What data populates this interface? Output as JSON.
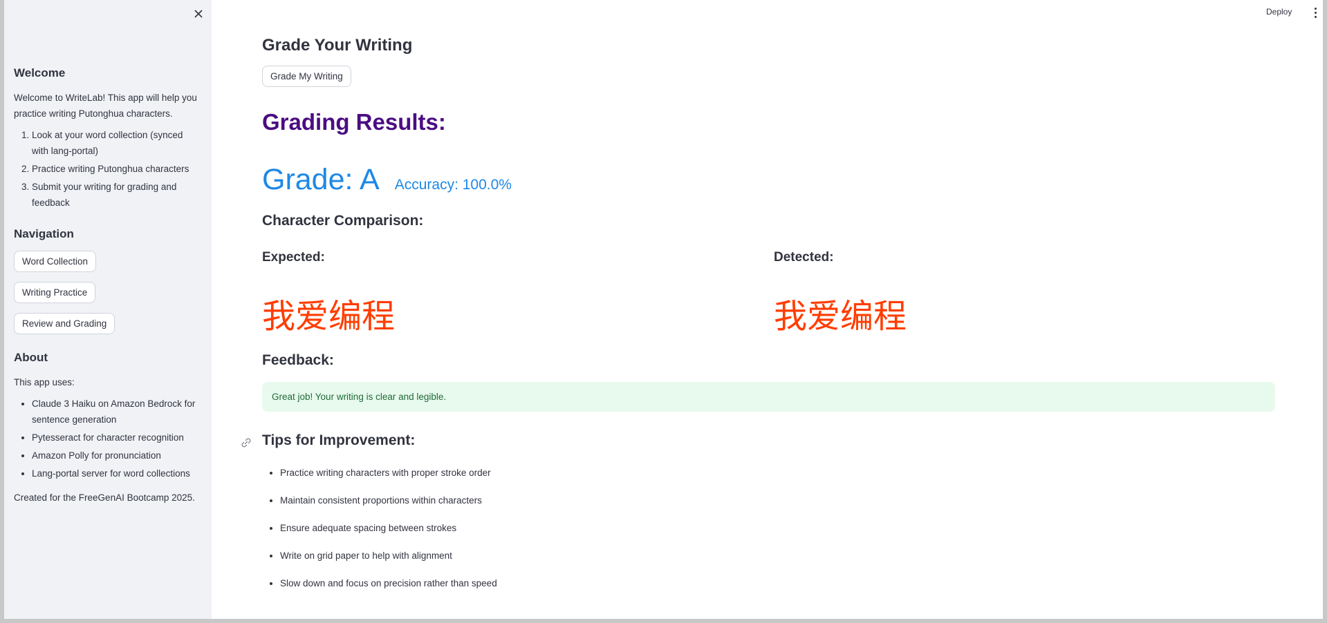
{
  "sidebar": {
    "welcome": {
      "title": "Welcome",
      "intro": "Welcome to WriteLab! This app will help you practice writing Putonghua characters.",
      "steps": [
        "Look at your word collection (synced with lang-portal)",
        "Practice writing Putonghua characters",
        "Submit your writing for grading and feedback"
      ]
    },
    "navigation": {
      "title": "Navigation",
      "buttons": [
        "Word Collection",
        "Writing Practice",
        "Review and Grading"
      ]
    },
    "about": {
      "title": "About",
      "intro": "This app uses:",
      "items": [
        "Claude 3 Haiku on Amazon Bedrock for sentence generation",
        "Pytesseract for character recognition",
        "Amazon Polly for pronunciation",
        "Lang-portal server for word collections"
      ],
      "footer": "Created for the FreeGenAI Bootcamp 2025."
    }
  },
  "toolbar": {
    "deploy_label": "Deploy"
  },
  "main": {
    "section_title": "Grade Your Writing",
    "grade_button": "Grade My Writing",
    "results_title": "Grading Results:",
    "grade": "Grade: A",
    "accuracy": "Accuracy: 100.0%",
    "comparison_title": "Character Comparison:",
    "expected_label": "Expected:",
    "expected_chars": "我爱编程",
    "detected_label": "Detected:",
    "detected_chars": "我爱编程",
    "feedback_title": "Feedback:",
    "feedback_text": "Great job! Your writing is clear and legible.",
    "tips_title": "Tips for Improvement:",
    "tips": [
      "Practice writing characters with proper stroke order",
      "Maintain consistent proportions within characters",
      "Ensure adequate spacing between strokes",
      "Write on grid paper to help with alignment",
      "Slow down and focus on precision rather than speed"
    ]
  },
  "colors": {
    "sidebar_bg": "#f0f2f6",
    "results_title": "#4b0d82",
    "grade": "#1e88e5",
    "characters": "#ff3d00",
    "feedback_bg": "#e8f9ee",
    "feedback_text": "#1f6b35"
  },
  "icons": [
    "close-icon",
    "more-vert-icon",
    "link-icon"
  ]
}
